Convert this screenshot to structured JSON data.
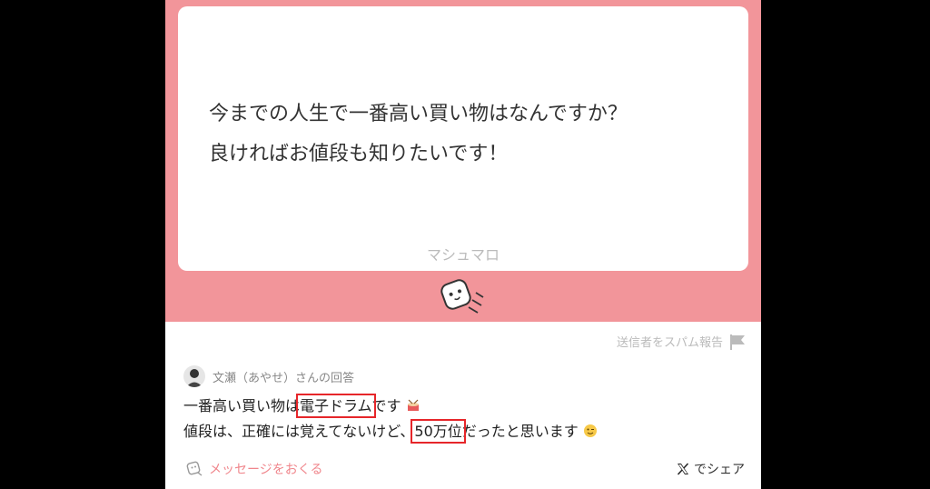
{
  "question": {
    "lines": [
      "今までの人生で一番高い買い物はなんですか？",
      "良ければお値段も知りたいです！"
    ],
    "brand": "マシュマロ"
  },
  "report_label": "送信者をスパム報告",
  "answer": {
    "author_label": "文瀬（あやせ）さんの回答",
    "line1_before": "一番高い買い物は",
    "line1_highlight": "電子ドラム",
    "line1_after": "です",
    "line2_before": "値段は、正確には覚えてないけど、",
    "line2_highlight": "50万位",
    "line2_after": "だったと思います"
  },
  "footer": {
    "send_message": "メッセージをおくる",
    "share": "でシェア"
  },
  "colors": {
    "accent_pink": "#f2959a",
    "link_pink": "#f0868c",
    "highlight_red": "#e6262a"
  },
  "icons": [
    "marshmallow-mascot-icon",
    "flag-icon",
    "avatar",
    "emoji-drum-icon",
    "emoji-wink-icon",
    "message-icon",
    "x-logo-icon"
  ]
}
